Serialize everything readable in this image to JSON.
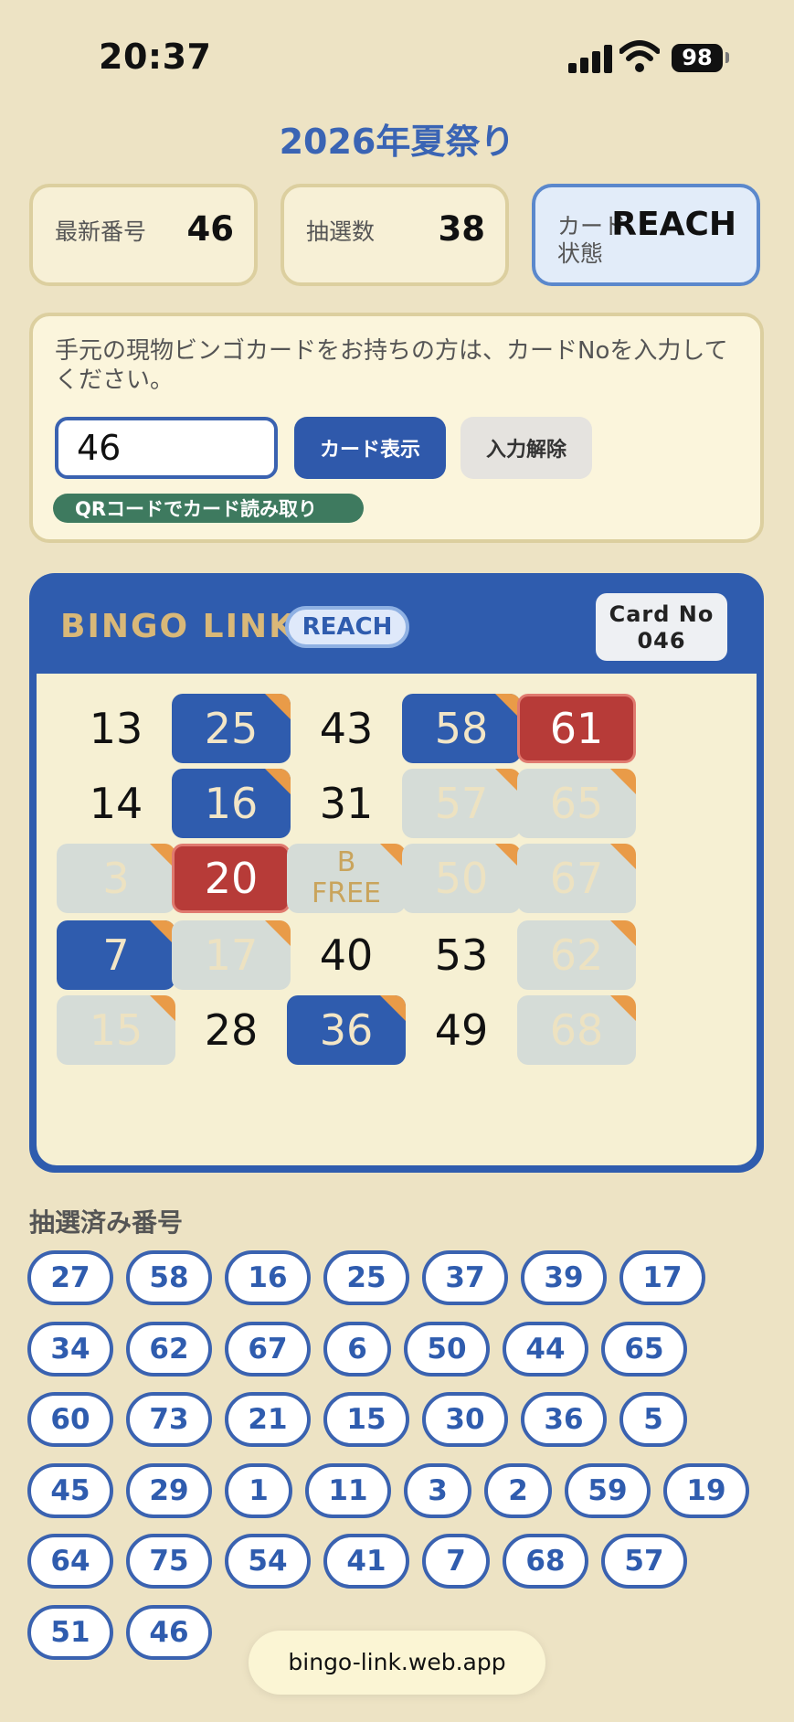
{
  "status_bar": {
    "time": "20:37",
    "battery": "98"
  },
  "event_title": "2026年夏祭り",
  "stats": [
    {
      "label": "最新番号",
      "value": "46"
    },
    {
      "label": "抽選数",
      "value": "38"
    },
    {
      "label": "カード状態",
      "value": "REACH"
    }
  ],
  "entry": {
    "notice": "手元の現物ビンゴカードをお持ちの方は、カードNoを入力してください。",
    "card_value": "46",
    "show_button": "カード表示",
    "clear_button": "入力解除",
    "qr_button": "QRコードでカード読み取り"
  },
  "card": {
    "brand": "BINGO LINK",
    "status_badge": "REACH",
    "card_no_label": "Card No",
    "card_no": "046",
    "rows": [
      [
        {
          "text": "13",
          "state": "plain"
        },
        {
          "text": "25",
          "state": "hit"
        },
        {
          "text": "43",
          "state": "plain"
        },
        {
          "text": "58",
          "state": "hit"
        },
        {
          "text": "61",
          "state": "win"
        }
      ],
      [
        {
          "text": "14",
          "state": "plain"
        },
        {
          "text": "16",
          "state": "hit"
        },
        {
          "text": "31",
          "state": "plain"
        },
        {
          "text": "57",
          "state": "miss"
        },
        {
          "text": "65",
          "state": "miss"
        }
      ],
      [
        {
          "text": "3",
          "state": "miss"
        },
        {
          "text": "20",
          "state": "win"
        },
        {
          "text": "B\nFREE",
          "state": "free"
        },
        {
          "text": "50",
          "state": "miss"
        },
        {
          "text": "67",
          "state": "miss"
        }
      ],
      [
        {
          "text": "7",
          "state": "hit"
        },
        {
          "text": "17",
          "state": "miss"
        },
        {
          "text": "40",
          "state": "plain"
        },
        {
          "text": "53",
          "state": "plain"
        },
        {
          "text": "62",
          "state": "miss"
        }
      ],
      [
        {
          "text": "15",
          "state": "miss"
        },
        {
          "text": "28",
          "state": "plain"
        },
        {
          "text": "36",
          "state": "hit"
        },
        {
          "text": "49",
          "state": "plain"
        },
        {
          "text": "68",
          "state": "miss"
        }
      ]
    ]
  },
  "drawn": {
    "title": "抽選済み番号",
    "numbers": [
      "27",
      "58",
      "16",
      "25",
      "37",
      "39",
      "17",
      "34",
      "62",
      "67",
      "6",
      "50",
      "44",
      "65",
      "60",
      "73",
      "21",
      "15",
      "30",
      "36",
      "5",
      "45",
      "29",
      "1",
      "11",
      "3",
      "2",
      "59",
      "19",
      "64",
      "75",
      "54",
      "41",
      "7",
      "68",
      "57",
      "51",
      "46"
    ]
  },
  "url_bar": "bingo-link.web.app",
  "colors": {
    "accent": "#2f5cae",
    "win": "#b73b38",
    "background": "#ede3c4",
    "mark": "#e99b48"
  }
}
